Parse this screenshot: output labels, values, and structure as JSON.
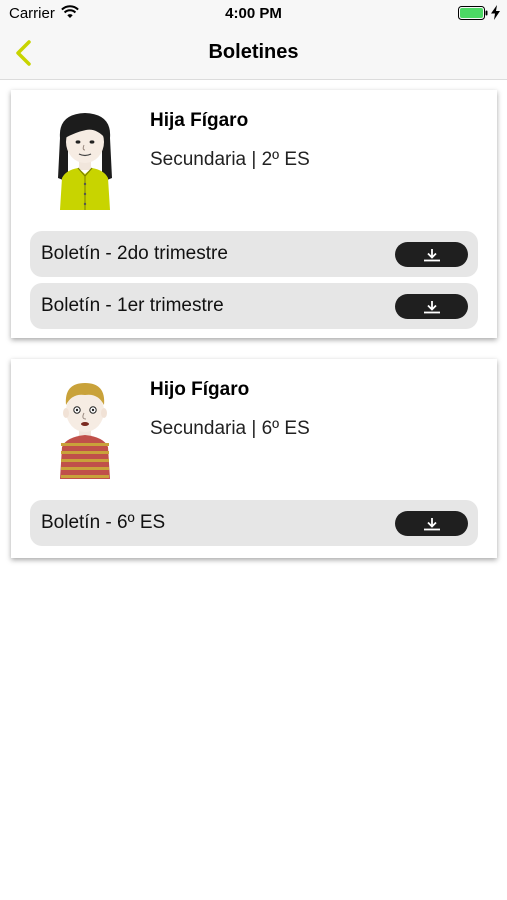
{
  "status_bar": {
    "carrier": "Carrier",
    "time": "4:00 PM",
    "wifi_icon": "wifi-icon",
    "battery_icon": "battery-icon",
    "charging_icon": "charging-bolt-icon",
    "battery_color": "#4cd964"
  },
  "nav": {
    "title": "Boletines",
    "back_icon": "chevron-left-icon",
    "accent_color": "#c8d400"
  },
  "students": [
    {
      "name": "Hija Fígaro",
      "course": "Secundaria | 2º ES",
      "avatar": "girl-avatar",
      "reports": [
        {
          "label": "Boletín - 2do trimestre",
          "icon": "download-icon"
        },
        {
          "label": "Boletín - 1er trimestre",
          "icon": "download-icon"
        }
      ]
    },
    {
      "name": "Hijo Fígaro",
      "course": "Secundaria | 6º ES",
      "avatar": "boy-avatar",
      "reports": [
        {
          "label": "Boletín - 6º ES",
          "icon": "download-icon"
        }
      ]
    }
  ]
}
